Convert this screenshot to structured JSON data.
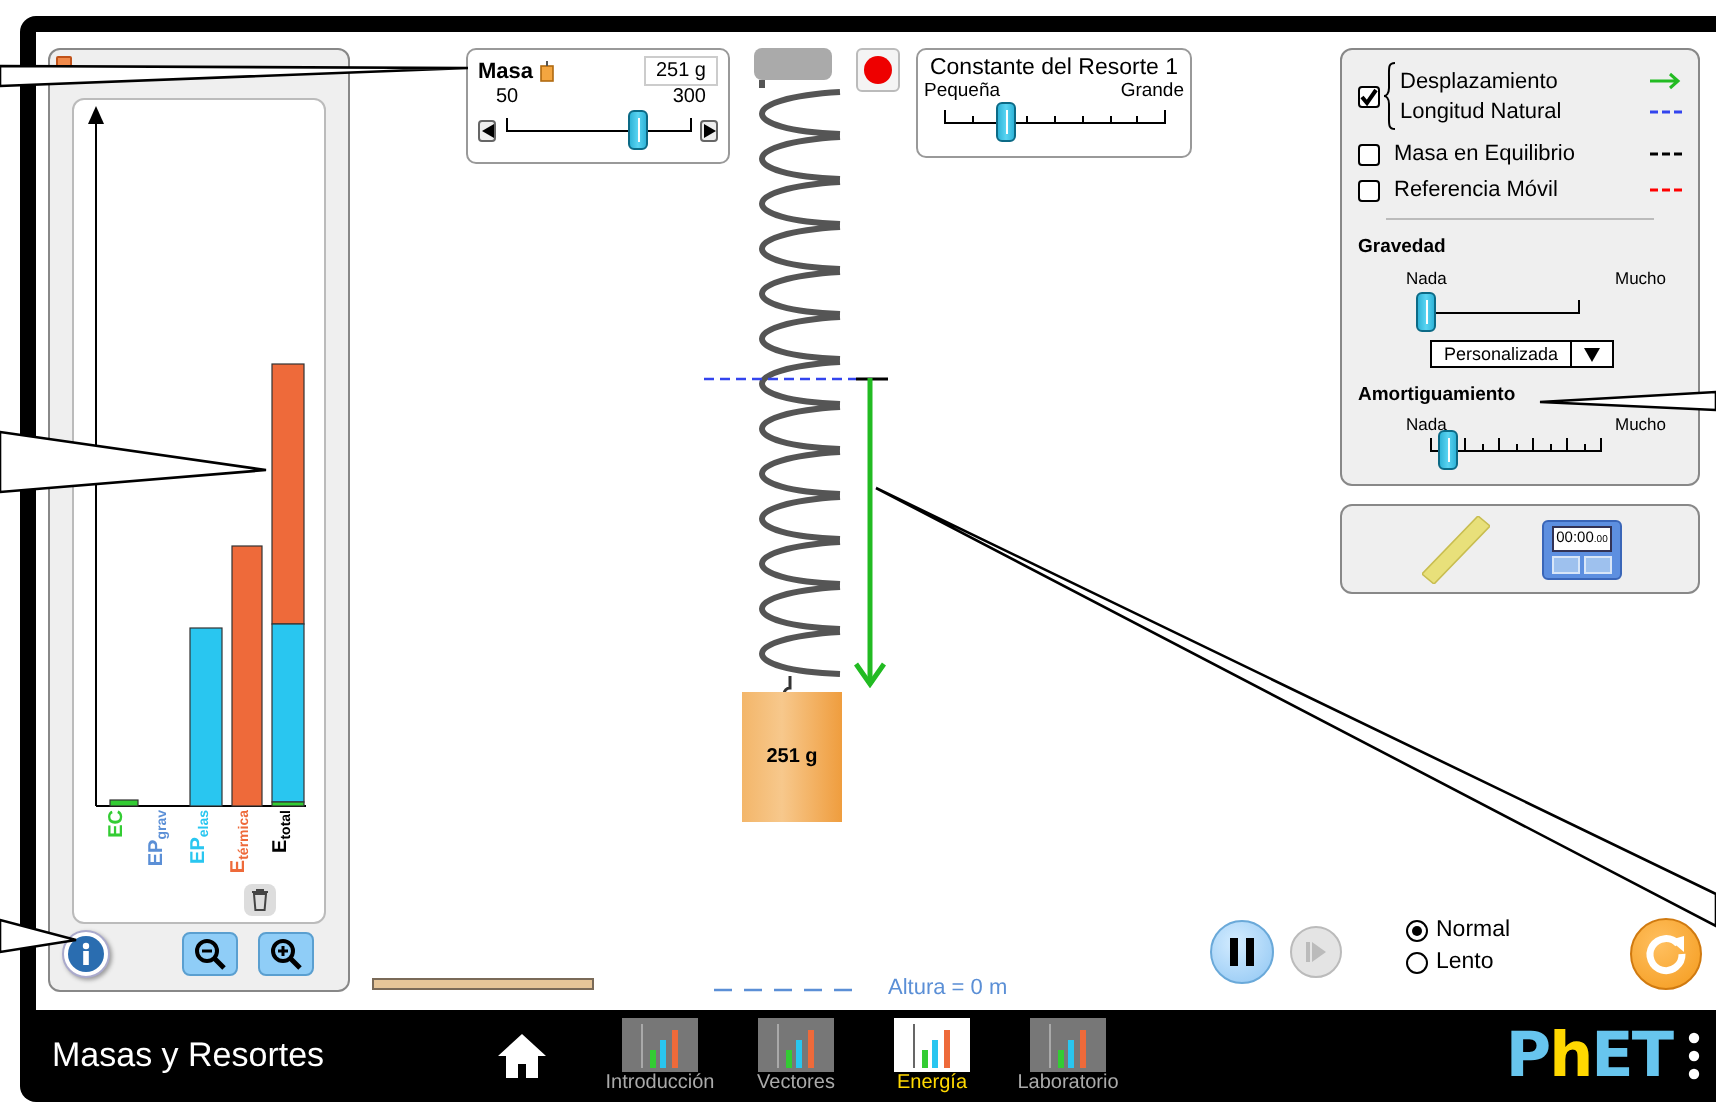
{
  "energy_panel": {
    "bar_labels": [
      {
        "text": "EC",
        "color": "#33cc33"
      },
      {
        "text": "EP$_{grav}$",
        "color": "#5b8fd6"
      },
      {
        "text": "EP$_{elas}$",
        "color": "#29c6f0"
      },
      {
        "text": "E$_{térmica}$",
        "color": "#ee6a3a"
      },
      {
        "text": "E$_{total}$",
        "color": "#000000"
      }
    ]
  },
  "mass_control": {
    "label": "Masa",
    "value": "251 g",
    "min_label": "50",
    "max_label": "300",
    "level": 0.72
  },
  "spring_constant": {
    "title": "Constante del Resorte 1",
    "min_label": "Pequeña",
    "max_label": "Grande",
    "level": 0.28
  },
  "mass_block": {
    "label": "251 g"
  },
  "height_reference": {
    "label": "Altura = 0 m"
  },
  "vector_group": {
    "checked": true,
    "items": [
      {
        "label": "Desplazamiento",
        "kind": "arrow",
        "color": "#22bb22"
      },
      {
        "label": "Longitud Natural",
        "kind": "dashed",
        "color": "#3344ee"
      }
    ]
  },
  "checkboxes": [
    {
      "label": "Masa en Equilibrio",
      "checked": false,
      "color": "#000000"
    },
    {
      "label": "Referencia Móvil",
      "checked": false,
      "color": "#ff0000"
    }
  ],
  "gravity": {
    "title": "Gravedad",
    "min_label": "Nada",
    "max_label": "Mucho",
    "level": 0.0,
    "preset": "Personalizada"
  },
  "damping": {
    "title": "Amortiguamiento",
    "min_label": "Nada",
    "max_label": "Mucho",
    "level": 0.1
  },
  "stopwatch": {
    "time": "00:00",
    "fraction": ".00"
  },
  "playback": {
    "playing": true,
    "step_disabled": true
  },
  "speed": [
    {
      "label": "Normal",
      "selected": true
    },
    {
      "label": "Lento",
      "selected": false
    }
  ],
  "nav": {
    "title": "Masas y Resortes",
    "logo": "PhET",
    "screens": [
      {
        "label": "Introducción",
        "selected": false
      },
      {
        "label": "Vectores",
        "selected": false
      },
      {
        "label": "Energía",
        "selected": true
      },
      {
        "label": "Laboratorio",
        "selected": false
      }
    ]
  }
}
